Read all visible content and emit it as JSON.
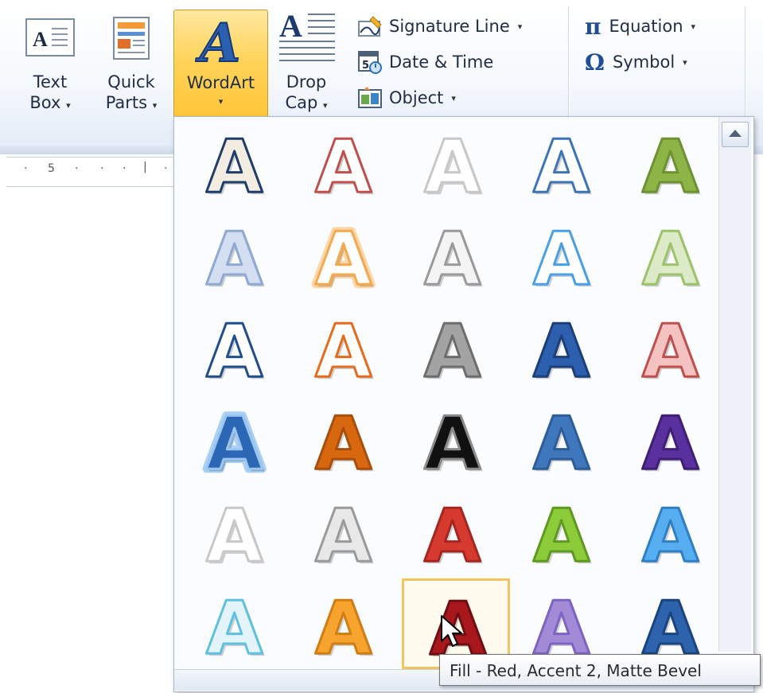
{
  "ribbon": {
    "text_box": {
      "line1": "Text",
      "line2": "Box",
      "caret": "▾",
      "icon": "text-box-icon"
    },
    "quick_parts": {
      "line1": "Quick",
      "line2": "Parts",
      "caret": "▾",
      "icon": "quick-parts-icon"
    },
    "wordart": {
      "label": "WordArt",
      "caret": "▾",
      "icon": "wordart-icon"
    },
    "drop_cap": {
      "line1": "Drop",
      "line2": "Cap",
      "caret": "▾",
      "icon": "drop-cap-icon"
    },
    "signature_line": {
      "label": "Signature Line",
      "caret": "▾",
      "icon": "signature-icon"
    },
    "date_time": {
      "label": "Date & Time",
      "icon": "calendar-icon"
    },
    "object": {
      "label": "Object",
      "caret": "▾",
      "icon": "object-icon"
    },
    "equation": {
      "symbol": "π",
      "label": "Equation",
      "caret": "▾"
    },
    "symbol": {
      "symbol": "Ω",
      "label": "Symbol",
      "caret": "▾"
    }
  },
  "ruler": {
    "label": "5"
  },
  "gallery": {
    "letter": "A",
    "styles": [
      {
        "fill": "#f3ece0",
        "stroke": "#1f3c6b",
        "glow": ""
      },
      {
        "fill": "#ffffff",
        "stroke": "#c0504d",
        "glow": ""
      },
      {
        "fill": "#ffffff",
        "stroke": "#c8c8c8",
        "glow": ""
      },
      {
        "fill": "#ffffff",
        "stroke": "#3d74b8",
        "glow": ""
      },
      {
        "fill": "#8db446",
        "stroke": "#6e9232",
        "glow": ""
      },
      {
        "fill": "#d3def0",
        "stroke": "#8fa9d2",
        "glow": ""
      },
      {
        "fill": "#ffffff",
        "stroke": "#f5a94e",
        "glow": "#fcd8a8"
      },
      {
        "fill": "#f4f4f4",
        "stroke": "#9a9a9a",
        "glow": ""
      },
      {
        "fill": "#ffffff",
        "stroke": "#4aa0e6",
        "glow": ""
      },
      {
        "fill": "#dceac8",
        "stroke": "#9cc26a",
        "glow": ""
      },
      {
        "fill": "#ffffff",
        "stroke": "#1f4e8c",
        "glow": ""
      },
      {
        "fill": "#ffffff",
        "stroke": "#e46c1e",
        "glow": ""
      },
      {
        "fill": "#a3a3a3",
        "stroke": "#6d6d6d",
        "glow": ""
      },
      {
        "fill": "#2c5fae",
        "stroke": "#1c3f78",
        "glow": ""
      },
      {
        "fill": "#f3c2c1",
        "stroke": "#c0504d",
        "glow": ""
      },
      {
        "fill": "#2b67b4",
        "stroke": "#9cc6f0",
        "glow": "#a9d0f5"
      },
      {
        "fill": "#d8680f",
        "stroke": "#a94e0a",
        "glow": ""
      },
      {
        "fill": "#111111",
        "stroke": "#8a8a8a",
        "glow": ""
      },
      {
        "fill": "#3f77bc",
        "stroke": "#2d5d99",
        "glow": ""
      },
      {
        "fill": "#5a2f9e",
        "stroke": "#3e1f73",
        "glow": ""
      },
      {
        "fill": "#ffffff",
        "stroke": "#c8c8c8",
        "glow": ""
      },
      {
        "fill": "#e8e8e8",
        "stroke": "#9a9a9a",
        "glow": ""
      },
      {
        "fill": "#d63a2f",
        "stroke": "#a52620",
        "glow": ""
      },
      {
        "fill": "#8ccc3a",
        "stroke": "#5e9a1f",
        "glow": ""
      },
      {
        "fill": "#56aef0",
        "stroke": "#2e7fc4",
        "glow": ""
      },
      {
        "fill": "#e3f5fb",
        "stroke": "#5fc0e2",
        "glow": ""
      },
      {
        "fill": "#f7a42e",
        "stroke": "#d07d11",
        "glow": ""
      },
      {
        "fill": "#a8171c",
        "stroke": "#6e0e12",
        "glow": ""
      },
      {
        "fill": "#a28ad7",
        "stroke": "#7d63c4",
        "glow": ""
      },
      {
        "fill": "#2d63ad",
        "stroke": "#1a447f",
        "glow": ""
      }
    ],
    "selected_index": 27
  },
  "tooltip": {
    "text": "Fill - Red, Accent 2, Matte Bevel"
  }
}
